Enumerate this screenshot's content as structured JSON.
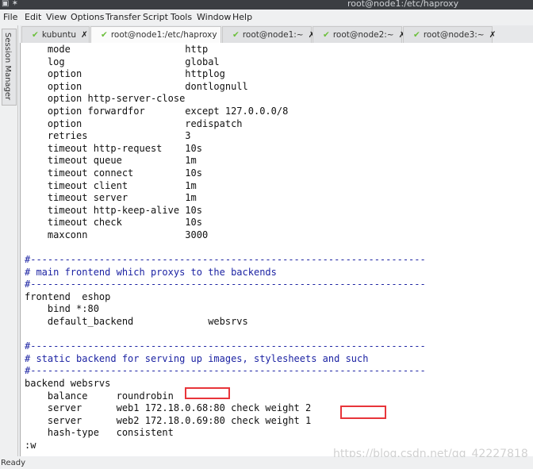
{
  "window": {
    "title": "root@node1:/etc/haproxy"
  },
  "menu": [
    "File",
    "Edit",
    "View",
    "Options",
    "Transfer",
    "Script",
    "Tools",
    "Window",
    "Help"
  ],
  "session_manager": "Session Manager",
  "tabs": [
    {
      "label": "kubuntu",
      "active": false
    },
    {
      "label": "root@node1:/etc/haproxy",
      "active": true
    },
    {
      "label": "root@node1:~",
      "active": false
    },
    {
      "label": "root@node2:~",
      "active": false
    },
    {
      "label": "root@node3:~",
      "active": false
    }
  ],
  "terminal_lines": [
    {
      "t": "    mode                    http"
    },
    {
      "t": "    log                     global"
    },
    {
      "t": "    option                  httplog"
    },
    {
      "t": "    option                  dontlognull"
    },
    {
      "t": "    option http-server-close"
    },
    {
      "t": "    option forwardfor       except 127.0.0.0/8"
    },
    {
      "t": "    option                  redispatch"
    },
    {
      "t": "    retries                 3"
    },
    {
      "t": "    timeout http-request    10s"
    },
    {
      "t": "    timeout queue           1m"
    },
    {
      "t": "    timeout connect         10s"
    },
    {
      "t": "    timeout client          1m"
    },
    {
      "t": "    timeout server          1m"
    },
    {
      "t": "    timeout http-keep-alive 10s"
    },
    {
      "t": "    timeout check           10s"
    },
    {
      "t": "    maxconn                 3000"
    },
    {
      "t": ""
    },
    {
      "t": "#---------------------------------------------------------------------",
      "c": true
    },
    {
      "t": "# main frontend which proxys to the backends",
      "c": true
    },
    {
      "t": "#---------------------------------------------------------------------",
      "c": true
    },
    {
      "t": "frontend  eshop"
    },
    {
      "t": "    bind *:80"
    },
    {
      "t": "    default_backend             websrvs"
    },
    {
      "t": ""
    },
    {
      "t": "#---------------------------------------------------------------------",
      "c": true
    },
    {
      "t": "# static backend for serving up images, stylesheets and such",
      "c": true
    },
    {
      "t": "#---------------------------------------------------------------------",
      "c": true
    },
    {
      "t": "backend websrvs"
    },
    {
      "t": "    balance     roundrobin"
    },
    {
      "t": "    server      web1 172.18.0.68:80 check weight 2"
    },
    {
      "t": "    server      web2 172.18.0.69:80 check weight 1"
    },
    {
      "t": "    hash-type   consistent"
    },
    {
      "t": ":w"
    }
  ],
  "status": "Ready",
  "watermark": "https://blog.csdn.net/qq_42227818",
  "colors": {
    "comment": "#1c23a3",
    "highlight_box": "#e8353a",
    "check": "#6bbf3a"
  }
}
